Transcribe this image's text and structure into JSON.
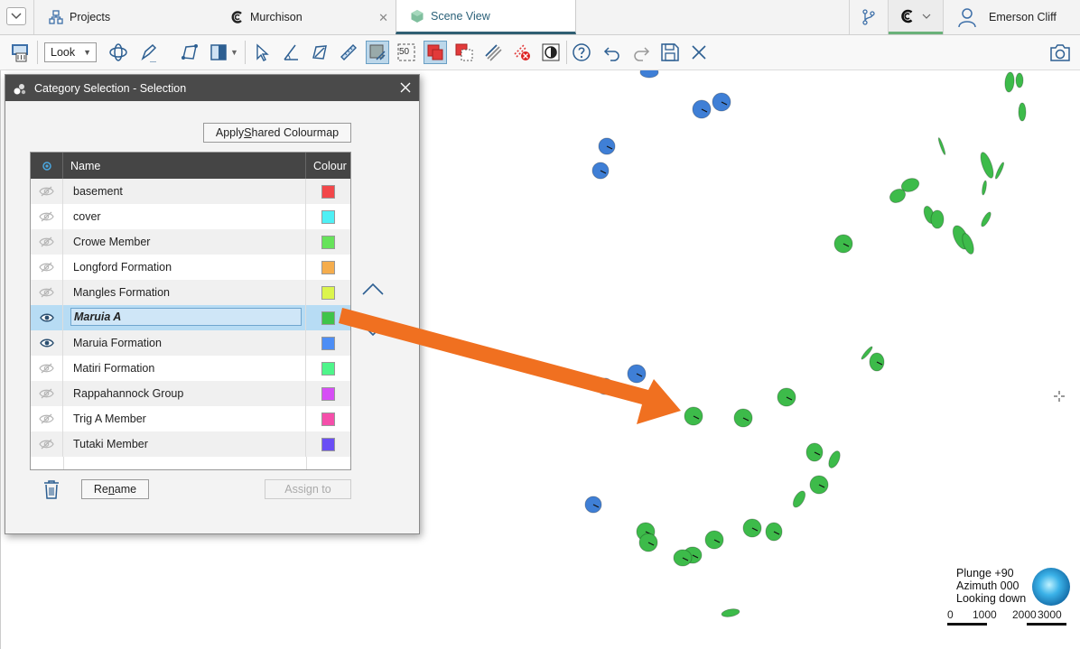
{
  "tabs": {
    "projects": "Projects",
    "murchison": "Murchison",
    "scene_view": "Scene View"
  },
  "user": {
    "name": "Emerson Cliff"
  },
  "toolbar": {
    "look_select": "Look",
    "zoom_level_badge": "50"
  },
  "dialog": {
    "title": "Category Selection - Selection",
    "apply_button": {
      "pre": "Apply ",
      "u": "S",
      "post": "hared Colourmap"
    },
    "rename_button": {
      "pre": "Re",
      "u": "n",
      "post": "ame"
    },
    "assign_button": "Assign to",
    "table": {
      "headers": {
        "name": "Name",
        "colour": "Colour"
      },
      "rows": [
        {
          "name": "basement",
          "color": "#f2474a",
          "visible": false
        },
        {
          "name": "cover",
          "color": "#4ef0f5",
          "visible": false
        },
        {
          "name": "Crowe Member",
          "color": "#66e35a",
          "visible": false
        },
        {
          "name": "Longford Formation",
          "color": "#f5ad4d",
          "visible": false
        },
        {
          "name": "Mangles Formation",
          "color": "#dcf54d",
          "visible": false
        },
        {
          "name": "Maruia A",
          "color": "#3fc44a",
          "visible": true,
          "selected": true,
          "editing": true
        },
        {
          "name": "Maruia Formation",
          "color": "#4d8ef5",
          "visible": true
        },
        {
          "name": "Matiri Formation",
          "color": "#4ef58a",
          "visible": false
        },
        {
          "name": "Rappahannock Group",
          "color": "#d64ef5",
          "visible": false
        },
        {
          "name": "Trig A Member",
          "color": "#f54eaa",
          "visible": false
        },
        {
          "name": "Tutaki Member",
          "color": "#6a4ef5",
          "visible": false
        }
      ]
    }
  },
  "viewport": {
    "plunge": "Plunge +90",
    "azimuth": "Azimuth 000",
    "looking": "Looking down",
    "scale_ticks": [
      "0",
      "1000",
      "2000",
      "3000"
    ],
    "annotation_arrow_color": "#f07020",
    "green_disc_color": "#3dbb4a",
    "blue_disc_color": "#3f7fd6"
  }
}
